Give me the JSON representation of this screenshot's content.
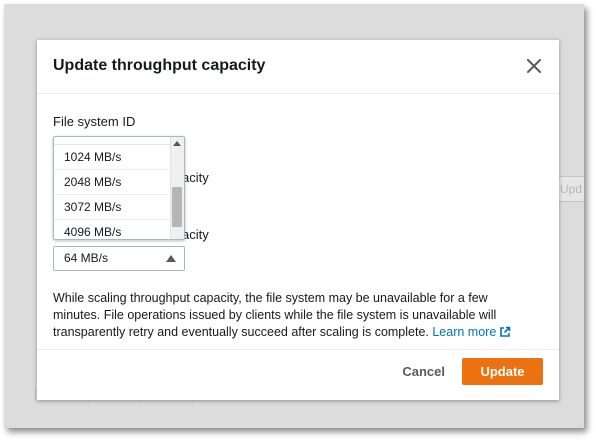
{
  "modal": {
    "title": "Update throughput capacity",
    "close_icon": "close-icon"
  },
  "form": {
    "file_system_id_label": "File system ID",
    "current_capacity_label_fragment": "acity",
    "desired_capacity_label_fragment": "acity",
    "dropdown_options": [
      "1024 MB/s",
      "2048 MB/s",
      "3072 MB/s",
      "4096 MB/s"
    ],
    "selected_value": "64 MB/s"
  },
  "note": {
    "text": "While scaling throughput capacity, the file system may be unavailable for a few minutes. File operations issued by clients while the file system is unavailable will transparently retry and eventually succeed after scaling is complete.",
    "link_text": "Learn more",
    "link_icon": "external-link-icon"
  },
  "footer": {
    "cancel_label": "Cancel",
    "update_label": "Update"
  },
  "background": {
    "button_fragment": "Upd"
  },
  "colors": {
    "primary": "#ec7211",
    "link": "#0073bb",
    "text": "#16191f"
  }
}
